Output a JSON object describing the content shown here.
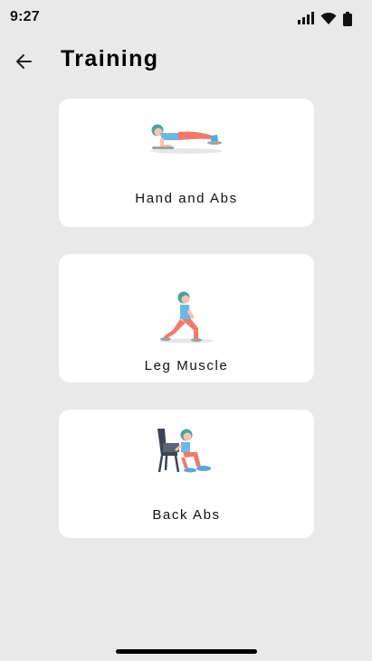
{
  "status_bar": {
    "time": "9:27",
    "icons": [
      "signal-icon",
      "wifi-icon",
      "battery-icon"
    ]
  },
  "header": {
    "back_icon": "arrow-left-icon",
    "title": "Training"
  },
  "cards": [
    {
      "label": "Hand and Abs",
      "illustration": "plank-exercise-illustration"
    },
    {
      "label": "Leg Muscle",
      "illustration": "lunge-exercise-illustration"
    },
    {
      "label": "Back Abs",
      "illustration": "chair-dip-exercise-illustration"
    }
  ],
  "colors": {
    "background": "#e9e9e9",
    "card": "#ffffff",
    "accent_skin": "#f07a6a",
    "accent_teal": "#4aa39a",
    "accent_blue": "#6fb7e3"
  }
}
